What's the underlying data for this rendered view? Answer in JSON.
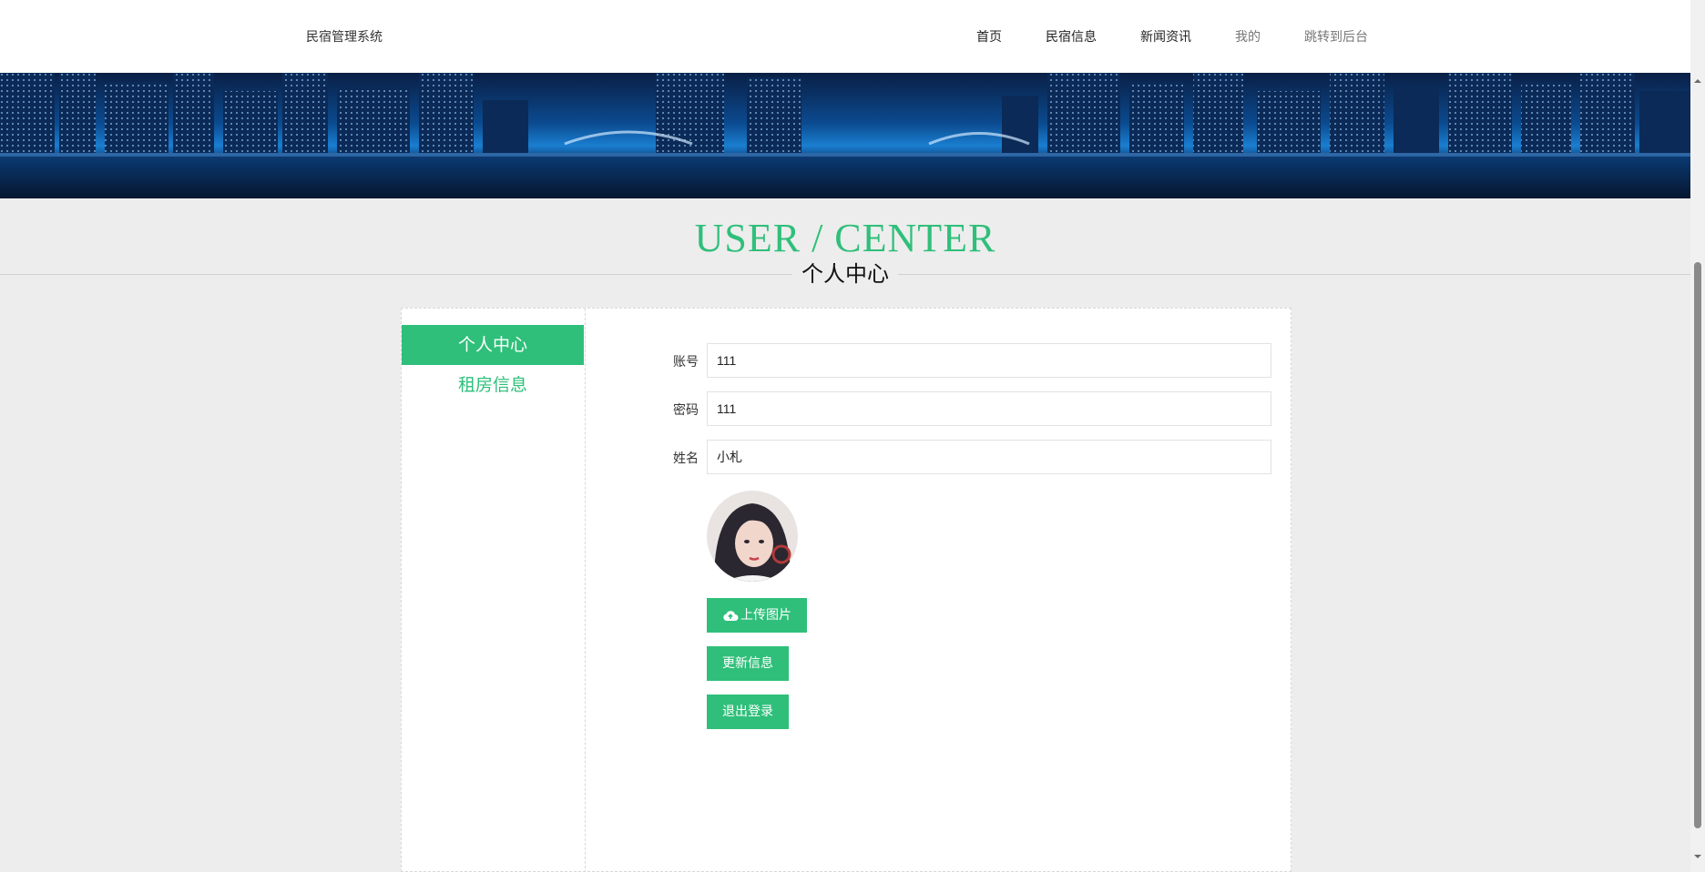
{
  "header": {
    "brand": "民宿管理系统",
    "nav": [
      {
        "label": "首页"
      },
      {
        "label": "民宿信息"
      },
      {
        "label": "新闻资讯"
      },
      {
        "label": "我的"
      },
      {
        "label": "跳转到后台"
      }
    ]
  },
  "section": {
    "title_en": "USER / CENTER",
    "title_zh": "个人中心"
  },
  "sidebar": {
    "items": [
      {
        "label": "个人中心",
        "active": true
      },
      {
        "label": "租房信息",
        "active": false
      }
    ]
  },
  "form": {
    "account": {
      "label": "账号",
      "value": "111"
    },
    "password": {
      "label": "密码",
      "value": "111"
    },
    "name": {
      "label": "姓名",
      "value": "小札"
    },
    "upload_label": "上传图片",
    "update_label": "更新信息",
    "logout_label": "退出登录"
  },
  "colors": {
    "accent": "#2fbf7a",
    "background": "#ededed"
  },
  "icons": {
    "upload": "cloud-upload-icon"
  }
}
